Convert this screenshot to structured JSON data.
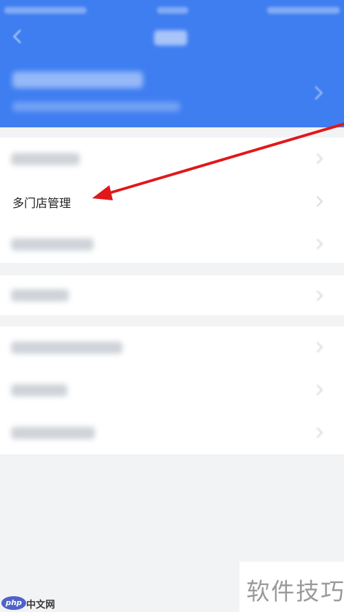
{
  "colors": {
    "header": "#3f7ef1",
    "background": "#f2f3f5",
    "arrow": "#e0181b"
  },
  "menu": {
    "highlighted_label": "多门店管理"
  },
  "watermark": {
    "text": "软件技巧"
  },
  "logo": {
    "mark": "php",
    "text": "中文网"
  }
}
